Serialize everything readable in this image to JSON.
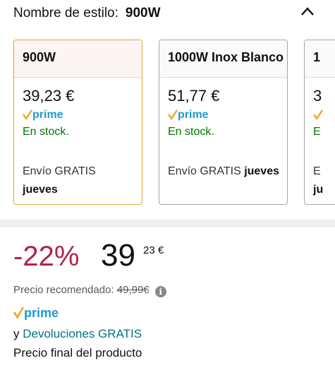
{
  "style_selector": {
    "label": "Nombre de estilo:",
    "value": "900W",
    "collapse_icon": "chevron-up-icon"
  },
  "options": [
    {
      "name": "900W",
      "price": "39,23 €",
      "prime_label": "prime",
      "stock": "En stock.",
      "shipping_prefix": "Envío GRATIS",
      "shipping_day": "jueves",
      "selected": true
    },
    {
      "name": "1000W Inox Blanco",
      "price": "51,77 €",
      "prime_label": "prime",
      "stock": "En stock.",
      "shipping_prefix": "Envío GRATIS",
      "shipping_day": "jueves",
      "selected": false
    },
    {
      "name": "1",
      "price": "3",
      "prime_label": "",
      "stock": "E",
      "shipping_prefix": "E",
      "shipping_day": "ju",
      "selected": false
    }
  ],
  "buybox": {
    "discount": "-22%",
    "price_whole": "39",
    "price_fraction": "23 €",
    "rrp_label": "Precio recomendado:",
    "rrp_value": "49,99€",
    "prime_label": "prime",
    "returns_prefix": "y",
    "returns_link": "Devoluciones GRATIS",
    "final_price_note": "Precio final del producto"
  },
  "colors": {
    "discount": "#b12248",
    "prime_blue": "#1b9ccc",
    "prime_check": "#f0a51c",
    "in_stock": "#007600",
    "link": "#007185",
    "selected_border": "#e4a53b"
  }
}
